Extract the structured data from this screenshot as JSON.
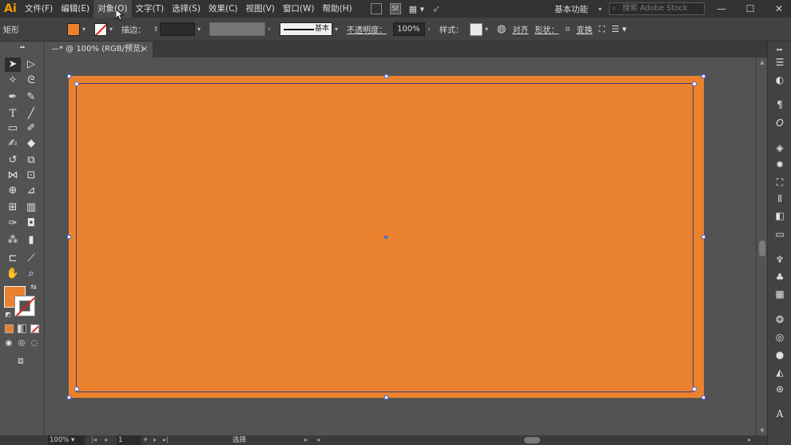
{
  "app": {
    "logo": "Ai"
  },
  "menu": {
    "items": [
      "文件(F)",
      "编辑(E)",
      "对象(O)",
      "文字(T)",
      "选择(S)",
      "效果(C)",
      "视图(V)",
      "窗口(W)",
      "帮助(H)"
    ],
    "active_index": 2,
    "bridge_label": "St"
  },
  "workspace": {
    "label": "基本功能"
  },
  "stock_search": {
    "placeholder": "搜索 Adobe Stock"
  },
  "window_controls": {
    "minimize": "—",
    "maximize": "☐",
    "close": "✕"
  },
  "control_bar": {
    "object_type": "矩形",
    "fill_color": "#ea812e",
    "stroke_label": "描边：",
    "stroke_weight": "",
    "stroke_style": "基本",
    "opacity_label": "不透明度：",
    "opacity_value": "100%",
    "style_label": "样式：",
    "align_label": "对齐",
    "shape_label": "形状：",
    "transform_label": "变换"
  },
  "document_tab": {
    "title": "—* @ 100% (RGB/预览)",
    "close": "×"
  },
  "tools": {
    "fill_color": "#ea812e",
    "icons": [
      "selection-icon",
      "direct-selection-icon",
      "magic-wand-icon",
      "lasso-icon",
      "pen-icon",
      "curvature-icon",
      "type-icon",
      "line-icon",
      "rectangle-icon",
      "paintbrush-icon",
      "shaper-icon",
      "eraser-icon",
      "rotate-icon",
      "scale-icon",
      "width-icon",
      "free-transform-icon",
      "shape-builder-icon",
      "perspective-icon",
      "mesh-icon",
      "gradient-icon",
      "eyedropper-icon",
      "blend-icon",
      "symbol-sprayer-icon",
      "column-graph-icon",
      "artboard-icon",
      "slice-icon",
      "hand-icon",
      "zoom-icon"
    ]
  },
  "canvas": {
    "artboard_color": "#ea812e",
    "selection_color": "#4b6fd6"
  },
  "status_bar": {
    "zoom": "100%",
    "page": "1",
    "status_text": "选择"
  },
  "right_panel": {
    "icons": [
      "libraries-icon",
      "color-icon",
      "paragraph-icon",
      "opentype-icon",
      "layers-icon",
      "appearance-icon",
      "transform-icon",
      "align-icon",
      "pathfinder-icon",
      "gradient-panel-icon",
      "brushes-icon",
      "symbols-icon",
      "swatches-icon",
      "graphic-styles-icon",
      "stroke-icon",
      "transparency-icon",
      "color-guide-icon",
      "navigator-icon",
      "character-icon"
    ]
  }
}
